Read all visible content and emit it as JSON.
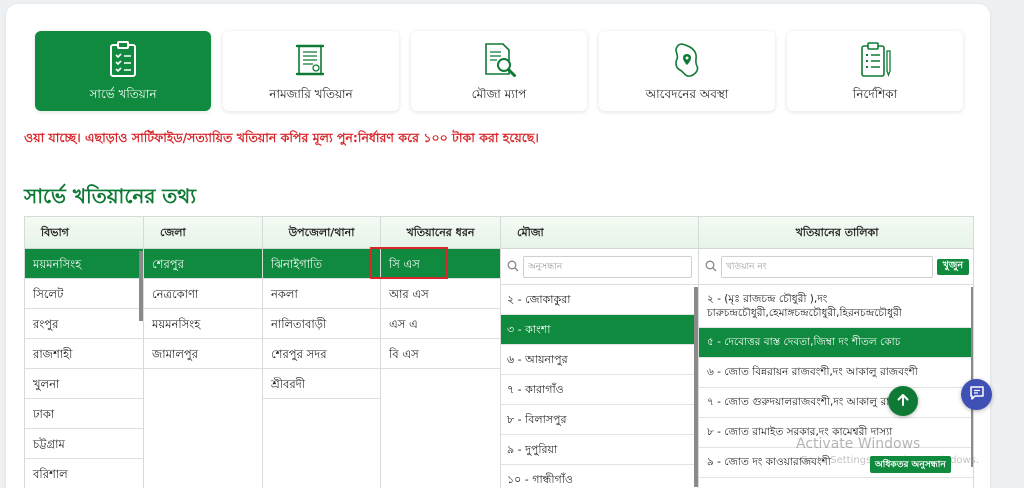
{
  "colors": {
    "brand_green": "#0f8a3e",
    "notice_red": "#d8262a",
    "chat_blue": "#3f51b5"
  },
  "tabs": [
    {
      "label": "সার্ভে খতিয়ান",
      "icon": "survey-doc-icon",
      "active": true
    },
    {
      "label": "নামজারি খতিয়ান",
      "icon": "scroll-doc-icon",
      "active": false
    },
    {
      "label": "মৌজা ম্যাপ",
      "icon": "map-search-icon",
      "active": false
    },
    {
      "label": "আবেদনের অবস্থা",
      "icon": "location-map-icon",
      "active": false
    },
    {
      "label": "নির্দেশিকা",
      "icon": "clipboard-list-icon",
      "active": false
    }
  ],
  "notice": "ওয়া যাচ্ছে। এছাড়াও সার্টিফাইড/সত্যায়িত খতিয়ান কপির মূল্য পুন:নির্ধারণ করে ১০০ টাকা করা হয়েছে।",
  "section_title": "সার্ভে খতিয়ানের তথ্য",
  "columns": {
    "division": {
      "header": "বিভাগ",
      "items": [
        "ময়মনসিংহ",
        "সিলেট",
        "রংপুর",
        "রাজশাহী",
        "খুলনা",
        "ঢাকা",
        "চট্টগ্রাম",
        "বরিশাল"
      ],
      "selected": 0
    },
    "district": {
      "header": "জেলা",
      "items": [
        "শেরপুর",
        "নেত্রকোণা",
        "ময়মনসিংহ",
        "জামালপুর"
      ],
      "selected": 0
    },
    "upazila": {
      "header": "উপজেলা/থানা",
      "items": [
        "ঝিনাইগাতি",
        "নকলা",
        "নালিতাবাড়ী",
        "শেরপুর সদর",
        "শ্রীবরদী"
      ],
      "selected": 0
    },
    "khatian_type": {
      "header": "খতিয়ানের ধরন",
      "items": [
        "সি এস",
        "আর এস",
        "এস এ",
        "বি এস"
      ],
      "selected": 0
    },
    "mouza": {
      "header": "মৌজা",
      "search_placeholder": "অনুসন্ধান",
      "items": [
        "২ - জোকাকুরা",
        "৩ - কাংশা",
        "৬ - আয়নাপুর",
        "৭ - কারাগাঁও",
        "৮ - বিলাসপুর",
        "৯ - দুপুরিয়া",
        "১০ - গান্ধীগাঁও"
      ],
      "selected": 1
    },
    "khatian_list": {
      "header": "খতিয়ানের তালিকা",
      "search_placeholder": "খতিয়ান নং",
      "search_button": "খুজুন",
      "items": [
        "২ - (মৃঃ রাজচন্দ্র চৌধুরী ),দং",
        "চারুচন্দ্রচৌধুরী,হেমাঙ্গচন্দ্রচৌধুরী,হিরনচন্দ্রচৌধুরী",
        "৫ - দেবোত্তর বাস্ত দেবতা,জিম্বা দং শীতল কোচ",
        "৬ - জোত বিন্নরায়ন রাজবংশী,দং আকালু রাজবংশী",
        "৭ - জোত গুরুদয়ালরাজবংশী,দং আকালু রাজবংশী",
        "৮ - জোত রামাইত সরকার,দং কামেশ্বরী দাস্যা",
        "৯ - জোত দং কাওয়ারাজবংশী"
      ],
      "more_button": "অধিকতর অনুসন্ধান"
    }
  },
  "watermark": {
    "line1": "Activate Windows",
    "line2": "Go to Settings to activate Windows."
  }
}
